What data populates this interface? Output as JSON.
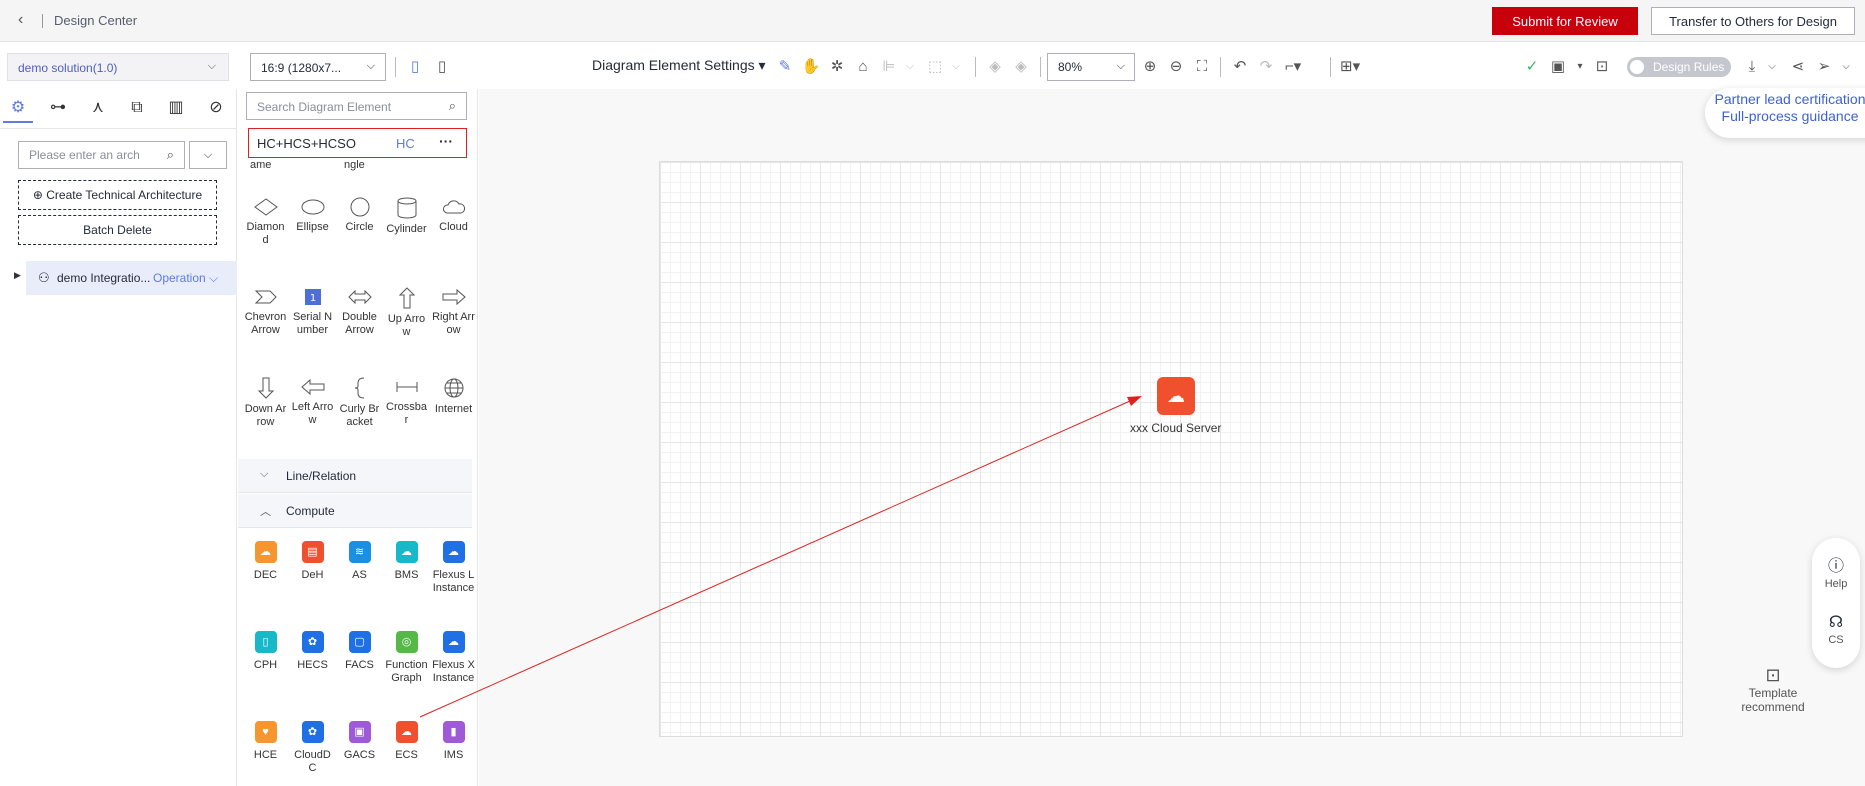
{
  "header": {
    "title": "Design Center",
    "submit_label": "Submit for Review",
    "transfer_label": "Transfer to Others for Design"
  },
  "toolbar": {
    "solution": "demo solution(1.0)",
    "ratio": "16:9 (1280x7...",
    "diagram_settings": "Diagram Element Settings",
    "zoom": "80%",
    "design_rules": "Design Rules"
  },
  "left_panel": {
    "search_placeholder": "Please enter an arch",
    "create_label": "Create Technical Architecture",
    "batch_delete_label": "Batch Delete",
    "tree": {
      "name": "demo Integratio...",
      "action": "Operation"
    }
  },
  "elements_panel": {
    "search_placeholder": "Search Diagram Element",
    "filter_primary": "HC+HCS+HCSO",
    "filter_secondary": "HC",
    "filter_more": "···",
    "fragments": [
      "ame",
      "ngle"
    ],
    "shapes": [
      {
        "label": "Diamond",
        "l1": "Diamon",
        "l2": "d"
      },
      {
        "label": "Ellipse",
        "l1": "Ellipse",
        "l2": ""
      },
      {
        "label": "Circle",
        "l1": "Circle",
        "l2": ""
      },
      {
        "label": "Cylinder",
        "l1": "Cylinder",
        "l2": ""
      },
      {
        "label": "Cloud",
        "l1": "Cloud",
        "l2": ""
      },
      {
        "label": "Chevron Arrow",
        "l1": "Chevron",
        "l2": "Arrow"
      },
      {
        "label": "Serial Number",
        "l1": "Serial N",
        "l2": "umber"
      },
      {
        "label": "Double Arrow",
        "l1": "Double",
        "l2": "Arrow"
      },
      {
        "label": "Up Arrow",
        "l1": "Up Arro",
        "l2": "w"
      },
      {
        "label": "Right Arrow",
        "l1": "Right Arr",
        "l2": "ow"
      },
      {
        "label": "Down Arrow",
        "l1": "Down Ar",
        "l2": "row"
      },
      {
        "label": "Left Arrow",
        "l1": "Left Arro",
        "l2": "w"
      },
      {
        "label": "Curly Bracket",
        "l1": "Curly Br",
        "l2": "acket"
      },
      {
        "label": "Crossbar",
        "l1": "Crossba",
        "l2": "r"
      },
      {
        "label": "Internet",
        "l1": "Internet",
        "l2": ""
      }
    ],
    "serial_number_glyph": "1",
    "sections": {
      "line_relation": "Line/Relation",
      "compute": "Compute"
    },
    "compute": [
      {
        "l1": "DEC",
        "l2": "",
        "color": "#f7962f"
      },
      {
        "l1": "DeH",
        "l2": "",
        "color": "#f1502f"
      },
      {
        "l1": "AS",
        "l2": "",
        "color": "#1890e6"
      },
      {
        "l1": "BMS",
        "l2": "",
        "color": "#17b8c8"
      },
      {
        "l1": "Flexus L",
        "l2": "Instance",
        "color": "#1f6fe5"
      },
      {
        "l1": "CPH",
        "l2": "",
        "color": "#17b8c8"
      },
      {
        "l1": "HECS",
        "l2": "",
        "color": "#1f6fe5"
      },
      {
        "l1": "FACS",
        "l2": "",
        "color": "#1f6fe5"
      },
      {
        "l1": "Function",
        "l2": "Graph",
        "color": "#55b947"
      },
      {
        "l1": "Flexus X",
        "l2": "Instance",
        "color": "#1f6fe5"
      },
      {
        "l1": "HCE",
        "l2": "",
        "color": "#f7962f"
      },
      {
        "l1": "CloudD",
        "l2": "C",
        "color": "#1f6fe5"
      },
      {
        "l1": "GACS",
        "l2": "",
        "color": "#a05ad8"
      },
      {
        "l1": "ECS",
        "l2": "",
        "color": "#f1502f"
      },
      {
        "l1": "IMS",
        "l2": "",
        "color": "#a05ad8"
      }
    ]
  },
  "canvas": {
    "node_label": "xxx Cloud Server"
  },
  "floating": {
    "partner_line1": "Partner lead certification",
    "partner_line2": "Full-process guidance",
    "help": "Help",
    "cs": "CS",
    "template_l1": "Template",
    "template_l2": "recommend"
  },
  "colors": {
    "accent": "#5e7ce0",
    "primary_red": "#c7000b",
    "arrow": "#e02020"
  }
}
